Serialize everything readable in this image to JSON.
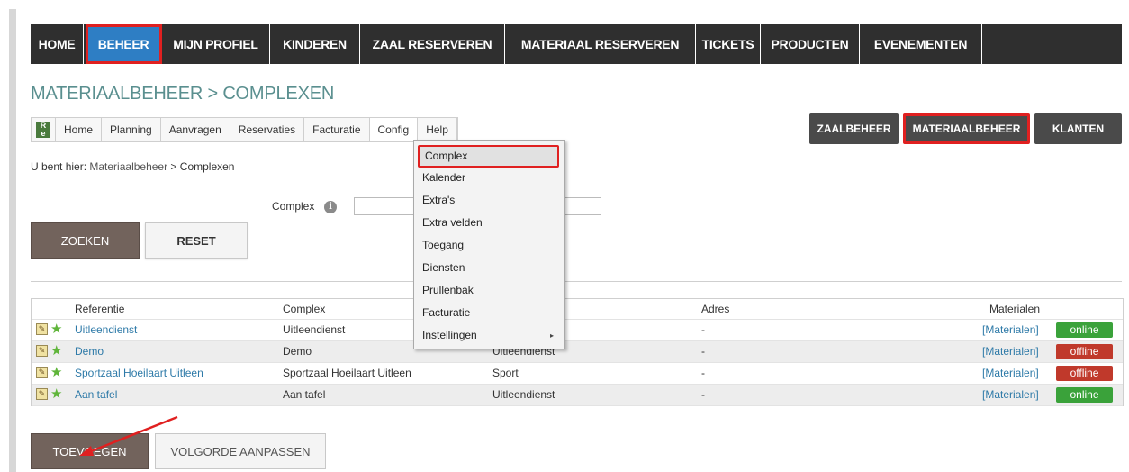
{
  "topnav": {
    "items": [
      {
        "label": "HOME"
      },
      {
        "label": "BEHEER"
      },
      {
        "label": "MIJN PROFIEL"
      },
      {
        "label": "KINDEREN"
      },
      {
        "label": "ZAAL RESERVEREN"
      },
      {
        "label": "MATERIAAL RESERVEREN"
      },
      {
        "label": "TICKETS"
      },
      {
        "label": "PRODUCTEN"
      },
      {
        "label": "EVENEMENTEN"
      }
    ],
    "active": "BEHEER"
  },
  "page": {
    "title": "MATERIAALBEHEER > COMPLEXEN"
  },
  "submenu": {
    "logo_text": "R e",
    "items": [
      {
        "label": "Home"
      },
      {
        "label": "Planning"
      },
      {
        "label": "Aanvragen"
      },
      {
        "label": "Reservaties"
      },
      {
        "label": "Facturatie"
      },
      {
        "label": "Config"
      },
      {
        "label": "Help"
      }
    ]
  },
  "config_dropdown": {
    "items": [
      {
        "label": "Complex"
      },
      {
        "label": "Kalender"
      },
      {
        "label": "Extra's"
      },
      {
        "label": "Extra velden"
      },
      {
        "label": "Toegang"
      },
      {
        "label": "Diensten"
      },
      {
        "label": "Prullenbak"
      },
      {
        "label": "Facturatie"
      },
      {
        "label": "Instellingen"
      }
    ],
    "selected": "Complex",
    "submenu_arrow": "▸"
  },
  "right_buttons": [
    {
      "label": "ZAALBEHEER"
    },
    {
      "label": "MATERIAALBEHEER"
    },
    {
      "label": "KLANTEN"
    }
  ],
  "breadcrumb": {
    "prefix": "U bent hier: ",
    "link": "Materiaalbeheer",
    "separator": " > ",
    "current": "Complexen"
  },
  "search": {
    "label": "Complex",
    "info_icon": "i",
    "value": "",
    "search_button": "ZOEKEN",
    "reset_button": "RESET"
  },
  "table": {
    "columns": [
      "Referentie",
      "Complex",
      "",
      "Adres",
      "Materialen"
    ],
    "rows": [
      {
        "ref": "Uitleendienst",
        "complex": "Uitleendienst",
        "type": "",
        "adres": "-",
        "materialen": "[Materialen]",
        "status": "online"
      },
      {
        "ref": "Demo",
        "complex": "Demo",
        "type": "Uitleendienst",
        "adres": "-",
        "materialen": "[Materialen]",
        "status": "offline"
      },
      {
        "ref": "Sportzaal Hoeilaart Uitleen",
        "complex": "Sportzaal Hoeilaart Uitleen",
        "type": "Sport",
        "adres": "-",
        "materialen": "[Materialen]",
        "status": "offline"
      },
      {
        "ref": "Aan tafel",
        "complex": "Aan tafel",
        "type": "Uitleendienst",
        "adres": "-",
        "materialen": "[Materialen]",
        "status": "online"
      }
    ],
    "edit_icon": "✎",
    "star_icon": "★"
  },
  "footer": {
    "add_button": "TOEVOEGEN",
    "order_button": "VOLGORDE AANPASSEN"
  },
  "colors": {
    "nav_bg": "#2f2f2f",
    "nav_active": "#2e7ec4",
    "highlight_red": "#e02020",
    "title_teal": "#5a8f8f",
    "link_blue": "#2e7aa8",
    "online_green": "#3aa23a",
    "offline_red": "#c0392b",
    "brown_button": "#72635c"
  }
}
